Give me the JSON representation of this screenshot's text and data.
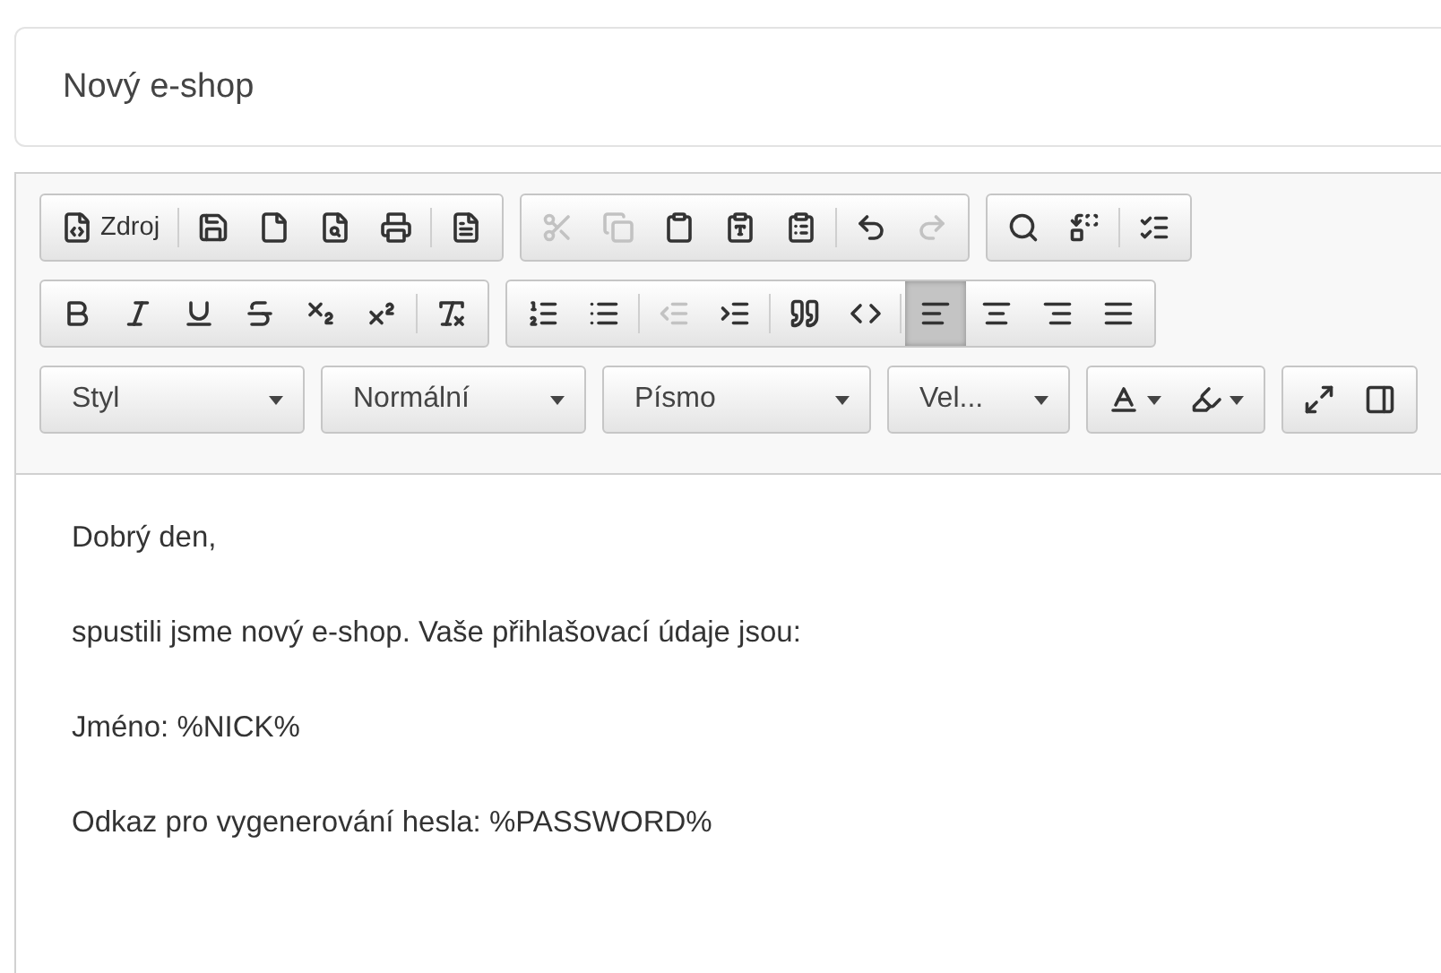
{
  "title_field": {
    "value": "Nový e-shop"
  },
  "toolbar": {
    "rows": [
      {
        "groups": [
          {
            "items": [
              {
                "kind": "button",
                "label": "Zdroj",
                "disabled": false,
                "selected": false
              },
              {
                "kind": "separator"
              },
              {
                "kind": "button",
                "disabled": false,
                "selected": false
              },
              {
                "kind": "button",
                "disabled": false,
                "selected": false
              },
              {
                "kind": "button",
                "disabled": false,
                "selected": false
              },
              {
                "kind": "button",
                "disabled": false,
                "selected": false
              },
              {
                "kind": "separator"
              },
              {
                "kind": "button",
                "disabled": false,
                "selected": false
              }
            ]
          },
          {
            "items": [
              {
                "kind": "button",
                "disabled": true,
                "selected": false
              },
              {
                "kind": "button",
                "disabled": true,
                "selected": false
              },
              {
                "kind": "button",
                "disabled": false,
                "selected": false
              },
              {
                "kind": "button",
                "disabled": false,
                "selected": false
              },
              {
                "kind": "button",
                "disabled": false,
                "selected": false
              },
              {
                "kind": "separator"
              },
              {
                "kind": "button",
                "disabled": false,
                "selected": false
              },
              {
                "kind": "button",
                "disabled": true,
                "selected": false
              }
            ]
          },
          {
            "items": [
              {
                "kind": "button",
                "disabled": false,
                "selected": false
              },
              {
                "kind": "button",
                "disabled": false,
                "selected": false
              },
              {
                "kind": "separator"
              },
              {
                "kind": "button",
                "disabled": false,
                "selected": false
              }
            ]
          }
        ]
      },
      {
        "groups": [
          {
            "items": [
              {
                "kind": "button",
                "disabled": false,
                "selected": false
              },
              {
                "kind": "button",
                "disabled": false,
                "selected": false
              },
              {
                "kind": "button",
                "disabled": false,
                "selected": false
              },
              {
                "kind": "button",
                "disabled": false,
                "selected": false
              },
              {
                "kind": "button",
                "disabled": false,
                "selected": false
              },
              {
                "kind": "button",
                "disabled": false,
                "selected": false
              },
              {
                "kind": "separator"
              },
              {
                "kind": "button",
                "disabled": false,
                "selected": false
              }
            ]
          },
          {
            "items": [
              {
                "kind": "button",
                "disabled": false,
                "selected": false
              },
              {
                "kind": "button",
                "disabled": false,
                "selected": false
              },
              {
                "kind": "separator"
              },
              {
                "kind": "button",
                "disabled": true,
                "selected": false
              },
              {
                "kind": "button",
                "disabled": false,
                "selected": false
              },
              {
                "kind": "separator"
              },
              {
                "kind": "button",
                "disabled": false,
                "selected": false
              },
              {
                "kind": "button",
                "disabled": false,
                "selected": false
              },
              {
                "kind": "separator"
              },
              {
                "kind": "button",
                "disabled": false,
                "selected": true
              },
              {
                "kind": "button",
                "disabled": false,
                "selected": false
              },
              {
                "kind": "button",
                "disabled": false,
                "selected": false
              },
              {
                "kind": "button",
                "disabled": false,
                "selected": false
              }
            ]
          }
        ]
      },
      {
        "groups": [
          {
            "items": [
              {
                "kind": "combo",
                "label": "Styl"
              }
            ]
          },
          {
            "items": [
              {
                "kind": "combo",
                "label": "Normální"
              }
            ]
          },
          {
            "items": [
              {
                "kind": "combo",
                "label": "Písmo"
              }
            ]
          },
          {
            "items": [
              {
                "kind": "combo",
                "label": "Vel..."
              }
            ]
          },
          {
            "items": [
              {
                "kind": "menubutton",
                "disabled": false,
                "selected": false
              },
              {
                "kind": "menubutton",
                "disabled": false,
                "selected": false
              }
            ]
          },
          {
            "items": [
              {
                "kind": "button",
                "disabled": false,
                "selected": false
              },
              {
                "kind": "button",
                "disabled": false,
                "selected": false
              }
            ]
          }
        ]
      }
    ]
  },
  "content": [
    "Dobrý den,",
    "spustili jsme nový e-shop. Vaše přihlašovací údaje jsou:",
    "Jméno: %NICK%",
    "Odkaz pro vygenerování hesla: %PASSWORD%"
  ]
}
